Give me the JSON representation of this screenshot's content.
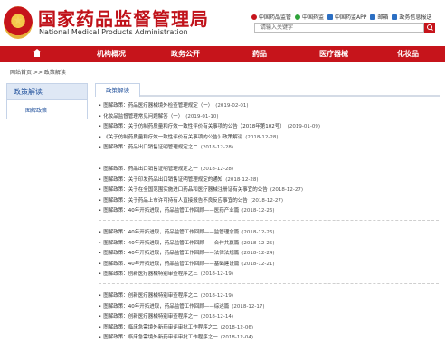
{
  "header": {
    "title": "国家药品监督管理局",
    "subtitle": "National Medical Products Administration",
    "top_links": [
      {
        "label": "中国药品监管",
        "icon": "weibo-icon"
      },
      {
        "label": "中国药监",
        "icon": "wechat-icon"
      },
      {
        "label": "中国药监APP",
        "icon": "app-icon"
      },
      {
        "label": "邮箱",
        "icon": "mail-icon"
      },
      {
        "label": "政务信息报送",
        "icon": "report-icon"
      }
    ],
    "search_placeholder": "请输入关键字"
  },
  "nav": {
    "items": [
      "机构概况",
      "政务公开",
      "药品",
      "医疗器械",
      "化妆品"
    ]
  },
  "breadcrumb": "网站首页 >> 政策解读",
  "sidebar": {
    "title": "政策解读",
    "items": [
      "图解政策"
    ]
  },
  "main": {
    "tab": "政策解读",
    "groups": [
      [
        {
          "title": "图解政策：药品医疗器械境外检查管理规定（一）",
          "date": "(2019-02-01)"
        },
        {
          "title": "化妆品监督管理常见问题解答（一）",
          "date": "(2019-01-10)"
        },
        {
          "title": "图解政策：关于仿制药质量和疗效一致性评价有关事项的公告（2018年第102号）",
          "date": "(2019-01-09)"
        },
        {
          "title": "《关于仿制药质量和疗效一致性评价有关事项的公告》政策解读",
          "date": "(2018-12-28)"
        },
        {
          "title": "图解政策：药品出口销售证明管理规定之二",
          "date": "(2018-12-28)"
        }
      ],
      [
        {
          "title": "图解政策：药品出口销售证明管理规定之一",
          "date": "(2018-12-28)"
        },
        {
          "title": "图解政策：关于印发药品出口销售证明管理规定的通知",
          "date": "(2018-12-28)"
        },
        {
          "title": "图解政策：关于在全国范围实施进口药品和医疗器械注册证有关事宜的公告",
          "date": "(2018-12-27)"
        },
        {
          "title": "图解政策：关于药品上市许可持有人直接报告不良反应事宜的公告",
          "date": "(2018-12-27)"
        },
        {
          "title": "图解政策：40年开拓进取，药品监管工作回顾——医药产业篇",
          "date": "(2018-12-26)"
        }
      ],
      [
        {
          "title": "图解政策：40年开拓进取，药品监管工作回顾——监管理念篇",
          "date": "(2018-12-26)"
        },
        {
          "title": "图解政策：40年开拓进取，药品监管工作回顾——合作共赢篇",
          "date": "(2018-12-25)"
        },
        {
          "title": "图解政策：40年开拓进取，药品监管工作回顾——法律法规篇",
          "date": "(2018-12-24)"
        },
        {
          "title": "图解政策：40年开拓进取，药品监管工作回顾——基础建设篇",
          "date": "(2018-12-21)"
        },
        {
          "title": "图解政策：创新医疗器械特别审查程序之三",
          "date": "(2018-12-19)"
        }
      ],
      [
        {
          "title": "图解政策：创新医疗器械特别审查程序之二",
          "date": "(2018-12-19)"
        },
        {
          "title": "图解政策：40年开拓进取，药品监管工作回顾——综述篇",
          "date": "(2018-12-17)"
        },
        {
          "title": "图解政策：创新医疗器械特别审查程序之一",
          "date": "(2018-12-14)"
        },
        {
          "title": "图解政策：临床急需境外新药审评审批工作程序之二",
          "date": "(2018-12-06)"
        },
        {
          "title": "图解政策：临床急需境外新药审评审批工作程序之一",
          "date": "(2018-12-04)"
        }
      ]
    ]
  },
  "colors": {
    "brand_red": "#c6141b",
    "link_blue": "#1d4e9a"
  }
}
